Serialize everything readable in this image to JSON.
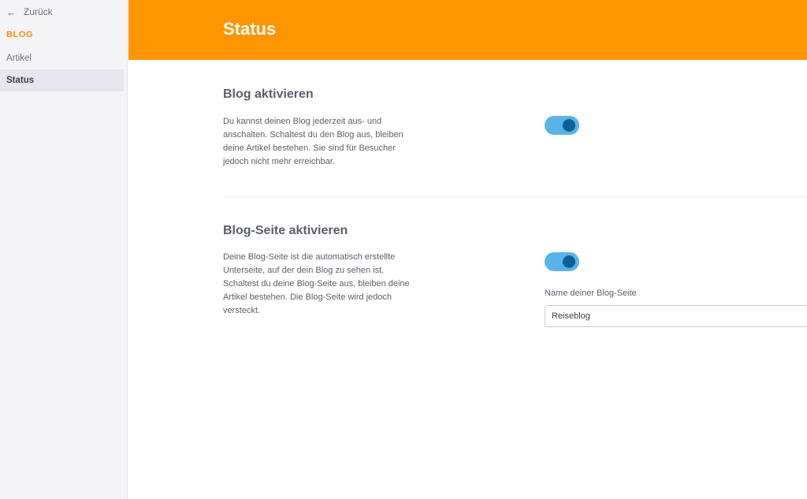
{
  "sidebar": {
    "back_label": "Zurück",
    "section_title": "BLOG",
    "items": [
      {
        "label": "Artikel",
        "active": false
      },
      {
        "label": "Status",
        "active": true
      }
    ]
  },
  "header": {
    "title": "Status",
    "color": "#ff9500"
  },
  "sections": {
    "blog": {
      "heading": "Blog aktivieren",
      "description": "Du kannst deinen Blog jederzeit aus- und anschalten. Schaltest du den Blog aus, bleiben deine Artikel bestehen. Sie sind für Besucher jedoch nicht mehr erreichbar.",
      "enabled": true
    },
    "blog_page": {
      "heading": "Blog-Seite aktivieren",
      "description": "Deine Blog-Seite ist die automatisch erstellte Unterseite, auf der dein Blog zu sehen ist. Schaltest du deine Blog-Seite aus, bleiben deine Artikel bestehen. Die Blog-Seite wird jedoch versteckt.",
      "enabled": true,
      "name_label": "Name deiner Blog-Seite",
      "name_value": "Reiseblog"
    }
  },
  "colors": {
    "accent": "#f39200",
    "toggle_track": "#58b4e6",
    "toggle_knob": "#0d5f9a"
  },
  "icons": {
    "back": "arrow-left-icon"
  }
}
